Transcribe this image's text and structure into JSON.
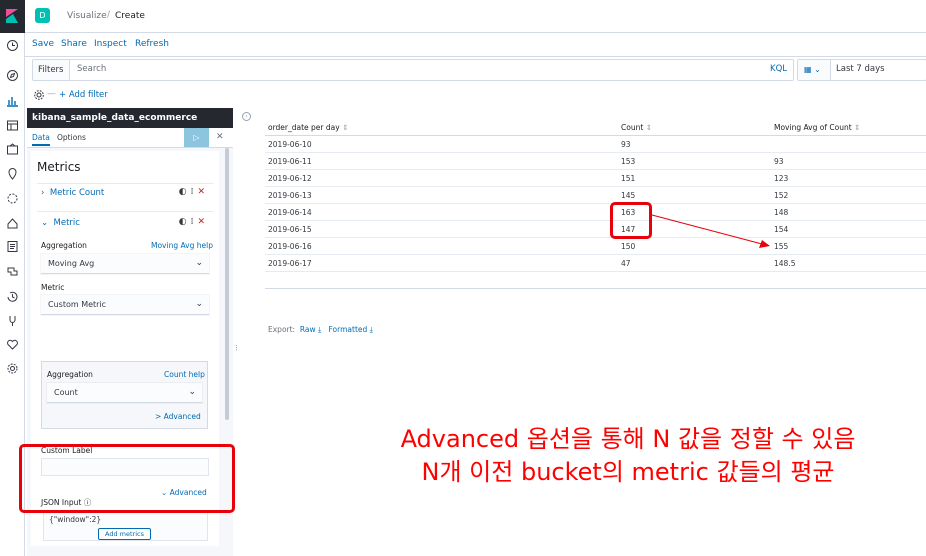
{
  "app": {
    "avatar_letter": "D",
    "breadcrumb": [
      "Visualize",
      "Create"
    ],
    "brand_color": "#006bb4"
  },
  "menu": {
    "items": [
      "Save",
      "Share",
      "Inspect",
      "Refresh"
    ]
  },
  "filters": {
    "label": "Filters",
    "search_placeholder": "Search",
    "kql": "KQL",
    "time_range": "Last 7 days",
    "add_filter": "+ Add filter"
  },
  "sidebar": {
    "index_pattern": "kibana_sample_data_ecommerce",
    "tabs": [
      "Data",
      "Options"
    ],
    "run_icon": "play-icon",
    "section_title": "Metrics",
    "metric1": {
      "label": "Metric Count"
    },
    "metric2": {
      "label": "Metric"
    },
    "aggregation_label": "Aggregation",
    "aggregation_help": "Moving Avg help",
    "aggregation_value": "Moving Avg",
    "metric_label": "Metric",
    "metric_value": "Custom Metric",
    "sub_aggregation_label": "Aggregation",
    "sub_aggregation_help": "Count help",
    "sub_aggregation_value": "Count",
    "advanced_link_1": "> Advanced",
    "custom_label": "Custom Label",
    "advanced_link_2": "Advanced",
    "json_input_label": "JSON Input",
    "json_input_value": "{\"window\":2}",
    "add_metrics": "Add metrics"
  },
  "table": {
    "columns": [
      "order_date per day",
      "Count",
      "Moving Avg of Count"
    ],
    "rows": [
      [
        "2019-06-10",
        "93",
        ""
      ],
      [
        "2019-06-11",
        "153",
        "93"
      ],
      [
        "2019-06-12",
        "151",
        "123"
      ],
      [
        "2019-06-13",
        "145",
        "152"
      ],
      [
        "2019-06-14",
        "163",
        "148"
      ],
      [
        "2019-06-15",
        "147",
        "154"
      ],
      [
        "2019-06-16",
        "150",
        "155"
      ],
      [
        "2019-06-17",
        "47",
        "148.5"
      ]
    ],
    "export_label": "Export:",
    "export_raw": "Raw",
    "export_formatted": "Formatted"
  },
  "annotation": {
    "line1": "Advanced 옵션을 통해 N 값을 정할 수 있음",
    "line2": "N개 이전 bucket의 metric 값들의 평균",
    "color": "#ff0000"
  }
}
